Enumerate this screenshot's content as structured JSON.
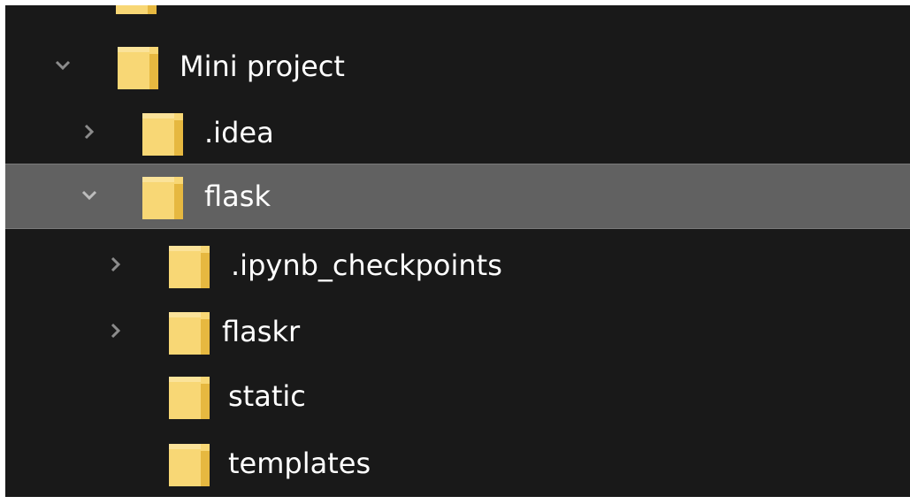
{
  "tree": {
    "items": [
      {
        "label": "Mini project",
        "expander": "chevron-down",
        "depth": 0,
        "selected": false
      },
      {
        "label": ".idea",
        "expander": "chevron-right",
        "depth": 1,
        "selected": false
      },
      {
        "label": "flask",
        "expander": "chevron-down",
        "depth": 1,
        "selected": true
      },
      {
        "label": ".ipynb_checkpoints",
        "expander": "chevron-right",
        "depth": 2,
        "selected": false
      },
      {
        "label": "flaskr",
        "expander": "chevron-right",
        "depth": 2,
        "selected": false
      },
      {
        "label": "static",
        "expander": "none",
        "depth": 2,
        "selected": false
      },
      {
        "label": "templates",
        "expander": "none",
        "depth": 2,
        "selected": false
      }
    ]
  },
  "colors": {
    "background": "#191919",
    "selected_row": "#616161",
    "folder_yellow": "#f8d775",
    "folder_shade": "#e6b840",
    "chevron": "#8c8c8c",
    "text": "#ffffff"
  }
}
